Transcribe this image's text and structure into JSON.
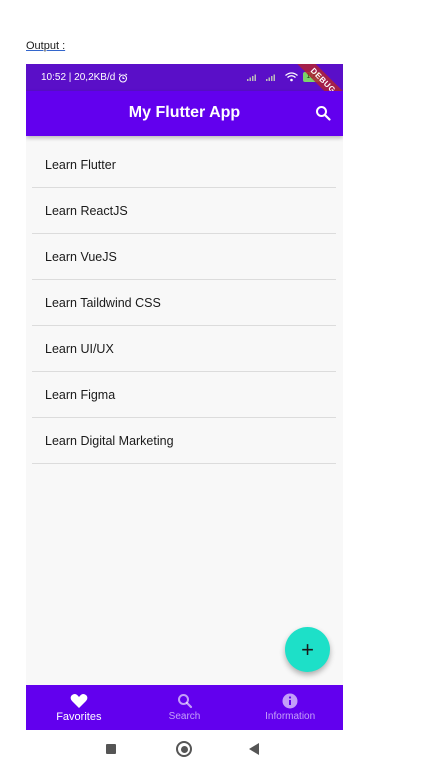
{
  "caption": "Output :",
  "status_bar": {
    "time_speed": "10:52 | 20,2KB/d",
    "battery": "100",
    "debug_banner": "DEBUG"
  },
  "app_bar": {
    "title": "My Flutter App",
    "search_icon": "search-icon"
  },
  "list": {
    "items": [
      {
        "label": "Learn Flutter"
      },
      {
        "label": "Learn ReactJS"
      },
      {
        "label": "Learn VueJS"
      },
      {
        "label": "Learn Taildwind CSS"
      },
      {
        "label": "Learn UI/UX"
      },
      {
        "label": "Learn Figma"
      },
      {
        "label": "Learn Digital Marketing"
      }
    ]
  },
  "fab": {
    "icon": "plus-icon",
    "glyph": "+"
  },
  "bottom_nav": {
    "items": [
      {
        "label": "Favorites",
        "icon": "heart-icon",
        "active": true
      },
      {
        "label": "Search",
        "icon": "search-icon",
        "active": false
      },
      {
        "label": "Information",
        "icon": "info-icon",
        "active": false
      }
    ]
  },
  "colors": {
    "primary": "#6200ee",
    "status_bar": "#5a0fc8",
    "fab": "#1de0c8",
    "background": "#f8f8f8"
  }
}
